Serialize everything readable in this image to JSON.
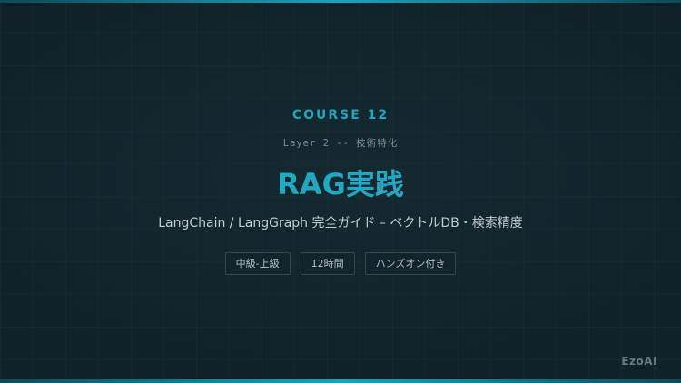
{
  "slide": {
    "course_number": "COURSE 12",
    "layer_label": "Layer 2 -- 技術特化",
    "title": "RAG実践",
    "subtitle": "LangChain / LangGraph 完全ガイド – ベクトルDB・検索精度",
    "tags": [
      "中級-上級",
      "12時間",
      "ハンズオン付き"
    ],
    "watermark": "EzoAI"
  },
  "colors": {
    "accent": "#21a9c4",
    "background": "#102127",
    "tag_border": "#2b4a53"
  }
}
